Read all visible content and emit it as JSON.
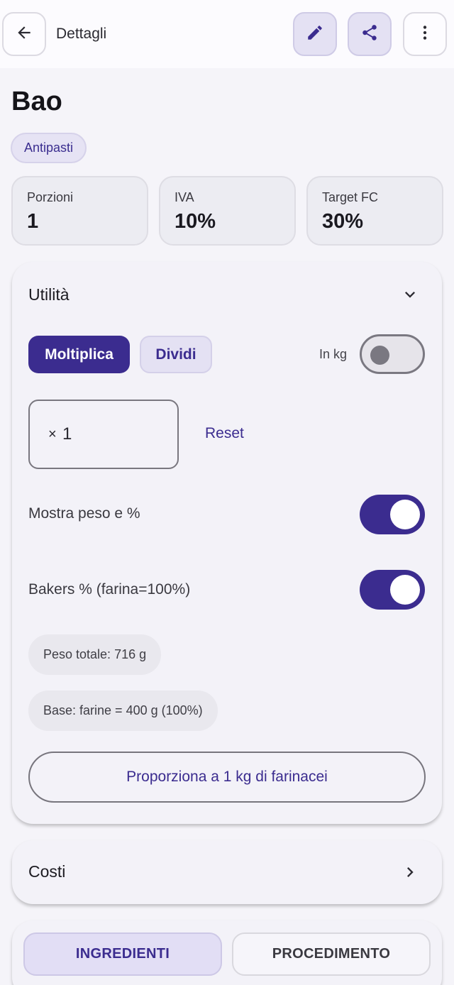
{
  "header": {
    "title": "Dettagli",
    "icons": {
      "back": "arrow-left-icon",
      "edit": "pencil-icon",
      "share": "share-icon",
      "more": "more-vertical-icon"
    }
  },
  "recipe": {
    "name": "Bao",
    "category": "Antipasti"
  },
  "stats": [
    {
      "label": "Porzioni",
      "value": "1"
    },
    {
      "label": "IVA",
      "value": "10%"
    },
    {
      "label": "Target FC",
      "value": "30%"
    }
  ],
  "utility": {
    "title": "Utilità",
    "expanded": true,
    "mode_buttons": {
      "multiply": "Moltiplica",
      "divide": "Dividi",
      "selected": "Moltiplica"
    },
    "in_kg": {
      "label": "In kg",
      "on": false
    },
    "multiplier": {
      "prefix": "×",
      "value": "1"
    },
    "reset_label": "Reset",
    "show_weight": {
      "label": "Mostra peso e %",
      "on": true
    },
    "bakers": {
      "label": "Bakers % (farina=100%)",
      "on": true
    },
    "total_weight": "Peso totale: 716 g",
    "base": "Base: farine = 400 g (100%)",
    "proportion_button": "Proporziona a 1 kg di farinacei"
  },
  "costs": {
    "title": "Costi"
  },
  "tabs": {
    "items": [
      "INGREDIENTI",
      "PROCEDIMENTO"
    ],
    "selected": "INGREDIENTI"
  },
  "colors": {
    "accent": "#3b2c8f",
    "accent_container": "#e4e1f3",
    "background": "#f5f4f9",
    "surface": "#f3f2f8"
  }
}
